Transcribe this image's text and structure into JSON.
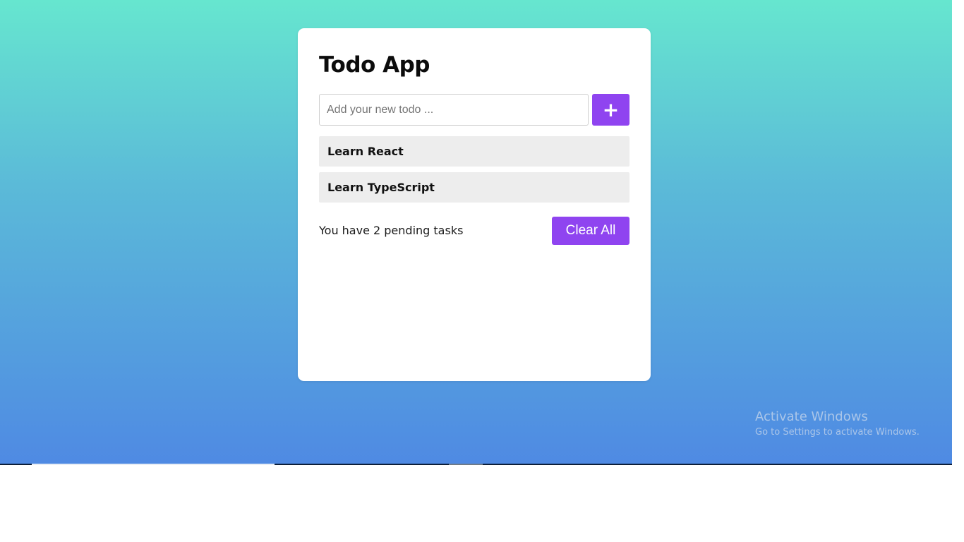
{
  "app": {
    "title": "Todo App"
  },
  "input": {
    "value": "",
    "placeholder": "Add your new todo ..."
  },
  "add_button": {
    "label": "+"
  },
  "todos": [
    {
      "text": "Learn React"
    },
    {
      "text": "Learn TypeScript"
    }
  ],
  "footer": {
    "pending_text": "You have 2 pending tasks",
    "clear_label": "Clear All"
  },
  "watermark": {
    "title": "Activate Windows",
    "subtitle": "Go to Settings to activate Windows."
  },
  "colors": {
    "accent": "#8f44f0",
    "gradient_top": "#66e6cf",
    "gradient_bottom": "#4f8ae3",
    "item_background": "#ededed"
  }
}
